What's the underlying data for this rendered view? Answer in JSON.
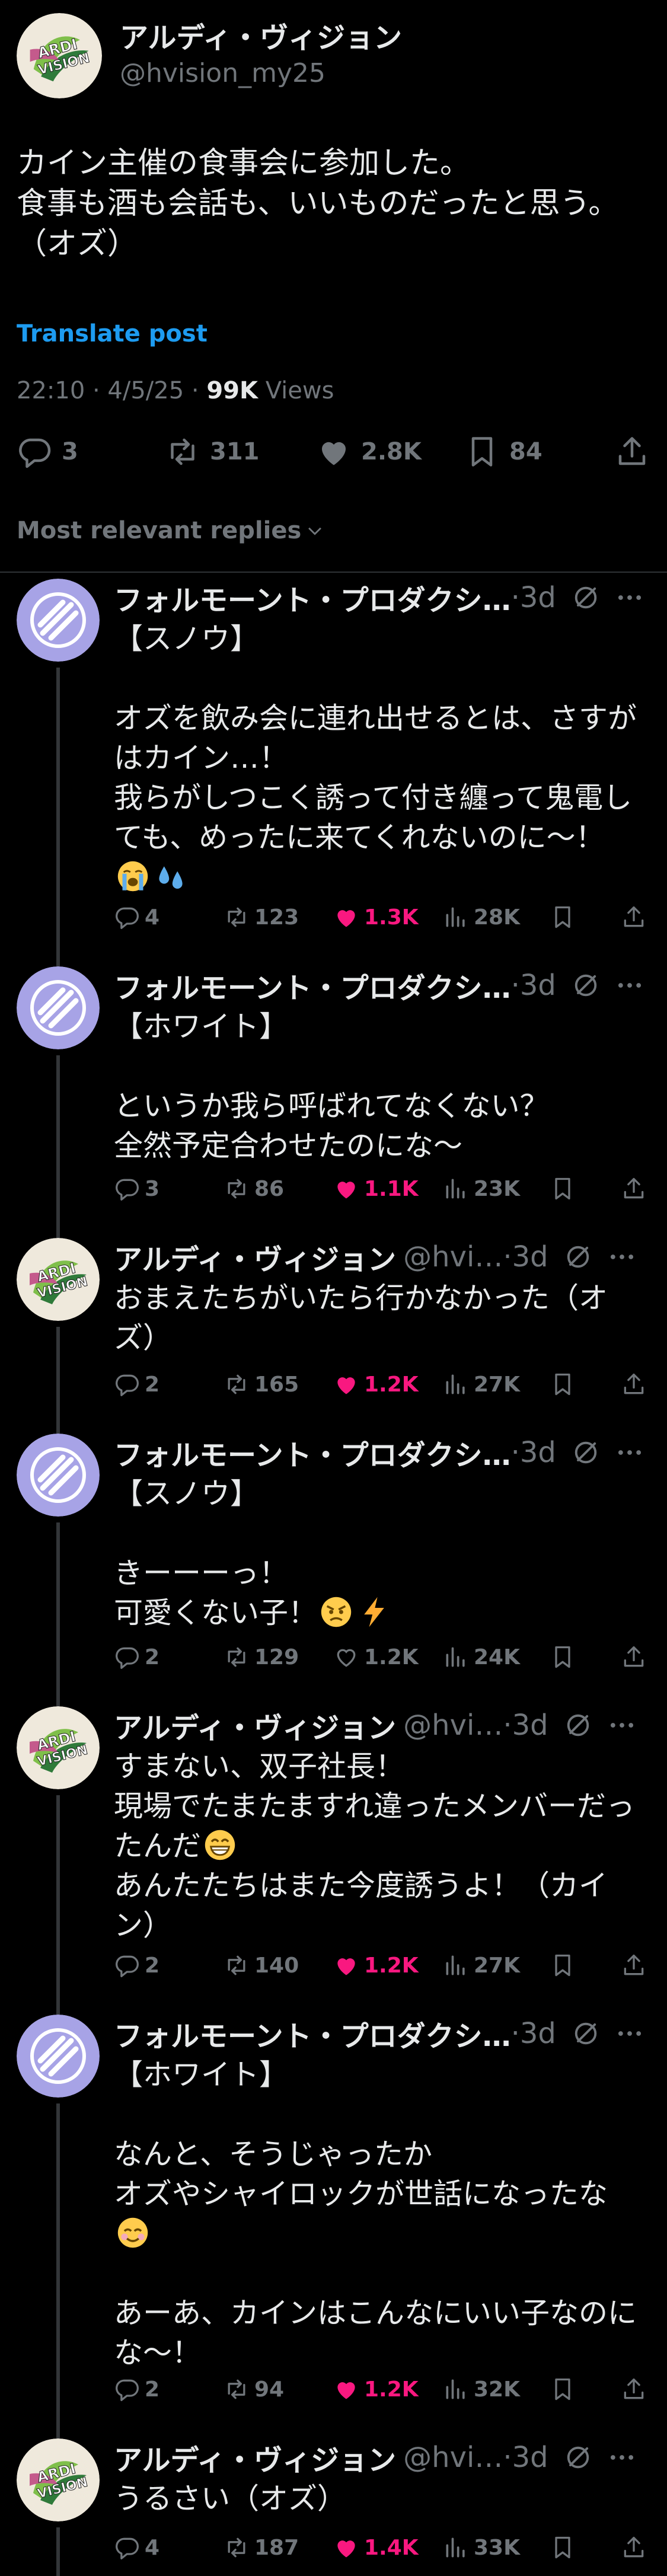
{
  "post": {
    "display_name": "アルディ・ヴィジョン",
    "username": "@hvision_my25",
    "avatar_text": "ARDI VISION",
    "text": "カイン主催の食事会に参加した。\n食事も酒も会話も、いいものだったと思う。（オズ）",
    "translate_label": "Translate post",
    "time": "22:10 · 4/5/25 · ",
    "views_count": "99K",
    "views_label": " Views",
    "replies": "3",
    "reposts": "311",
    "likes": "2.8K",
    "bookmarks": "84"
  },
  "sort_label": "Most relevant replies",
  "colors": {
    "accent": "#1d9bf0",
    "like": "#f91880",
    "muted": "#71767b",
    "avatar_purple": "#a7a3e6"
  },
  "replies": [
    {
      "name": "フォルモーント・プロダクシ…",
      "handle": "",
      "time": "·3d",
      "text": "【スノウ】\n\nオズを飲み会に連れ出せるとは、さすがはカイン…！\n我らがしつこく誘って付き纏って鬼電しても、めったに来てくれないのに〜！",
      "emojis": [
        "loudly-crying-face",
        "sweat-droplets"
      ],
      "replies": "4",
      "reposts": "123",
      "likes": "1.3K",
      "views": "28K"
    },
    {
      "name": "フォルモーント・プロダクシ…",
      "handle": "",
      "time": "·3d",
      "text": "【ホワイト】\n\nというか我ら呼ばれてなくない？\n全然予定合わせたのにな〜",
      "replies": "3",
      "reposts": "86",
      "likes": "1.1K",
      "views": "23K"
    },
    {
      "name": "アルディ・ヴィジョン",
      "handle": "@hvi…",
      "time": "·3d",
      "text": "おまえたちがいたら行かなかった（オズ）",
      "replies": "2",
      "reposts": "165",
      "likes": "1.2K",
      "views": "27K"
    },
    {
      "name": "フォルモーント・プロダクシ…",
      "handle": "",
      "time": "·3d",
      "text": "【スノウ】\n\nきーーーっ！\n可愛くない子！",
      "emojis": [
        "angry-face",
        "high-voltage"
      ],
      "replies": "2",
      "reposts": "129",
      "likes": "1.2K",
      "views": "24K"
    },
    {
      "name": "アルディ・ヴィジョン",
      "handle": "@hvi…",
      "time": "·3d",
      "text": "すまない、双子社長！\n現場でたまたますれ違ったメンバーだったんだ",
      "text_after": "\nあんたたちはまた今度誘うよ！（カイン）",
      "emojis": [
        "grinning-face"
      ],
      "replies": "2",
      "reposts": "140",
      "likes": "1.2K",
      "views": "27K"
    },
    {
      "name": "フォルモーント・プロダクシ…",
      "handle": "",
      "time": "·3d",
      "text": "【ホワイト】\n\nなんと、そうじゃったか\nオズやシャイロックが世話になったな",
      "text_after": "\n\nあーあ、カインはこんなにいい子なのにな〜！",
      "emojis": [
        "smiling-face"
      ],
      "replies": "2",
      "reposts": "94",
      "likes": "1.2K",
      "views": "32K"
    },
    {
      "name": "アルディ・ヴィジョン",
      "handle": "@hvi…",
      "time": "·3d",
      "text": "うるさい（オズ）",
      "replies": "4",
      "reposts": "187",
      "likes": "1.4K",
      "views": "33K"
    }
  ]
}
